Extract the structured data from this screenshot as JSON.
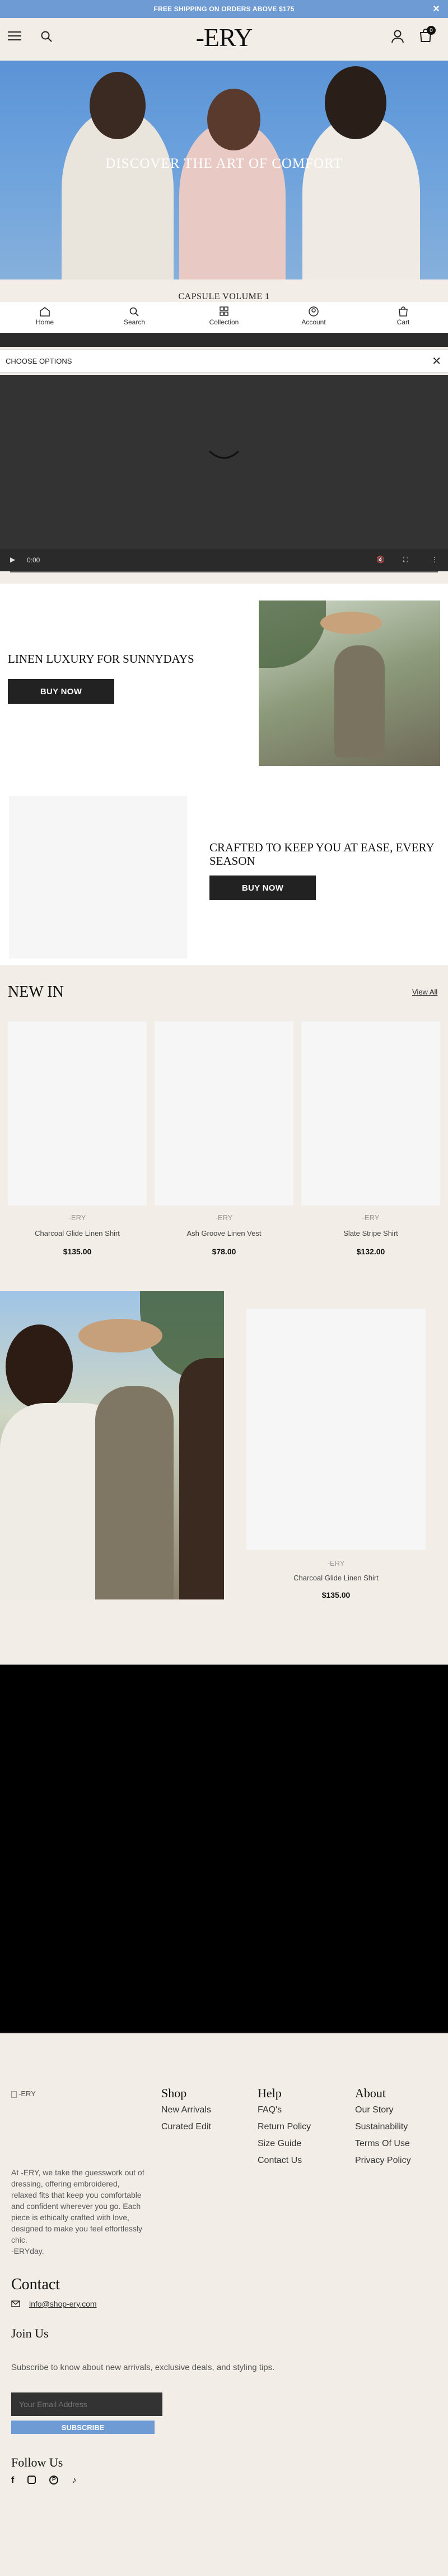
{
  "announcement": {
    "text": "FREE SHIPPING ON ORDERS ABOVE $175",
    "close": "✕"
  },
  "header": {
    "logo": "-ERY",
    "cart_count": "0"
  },
  "hero": {
    "title": "DISCOVER THE ART OF COMFORT",
    "subtitle": "CAPSULE VOLUME 1"
  },
  "bottom_nav": [
    {
      "label": "Home",
      "icon": "home-icon"
    },
    {
      "label": "Search",
      "icon": "search-icon"
    },
    {
      "label": "Collection",
      "icon": "grid-icon"
    },
    {
      "label": "Account",
      "icon": "account-icon"
    },
    {
      "label": "Cart",
      "icon": "cart-icon"
    }
  ],
  "options_bar": {
    "label": "CHOOSE OPTIONS"
  },
  "video": {
    "time": "0:00"
  },
  "linen": {
    "title": "LINEN LUXURY FOR SUNNYDAYS",
    "button": "BUY NOW"
  },
  "crafted": {
    "title": "CRAFTED TO KEEP YOU AT EASE, EVERY SEASON",
    "button": "BUY NOW"
  },
  "new_in": {
    "title": "NEW IN",
    "view_all": "View All",
    "products": [
      {
        "brand": "-ERY",
        "name": "Charcoal Glide Linen Shirt",
        "price": "$135.00"
      },
      {
        "brand": "-ERY",
        "name": "Ash Groove Linen Vest",
        "price": "$78.00"
      },
      {
        "brand": "-ERY",
        "name": "Slate Stripe Shirt",
        "price": "$132.00"
      }
    ]
  },
  "feature_product": {
    "brand": "-ERY",
    "name": "Charcoal Glide Linen Shirt",
    "price": "$135.00"
  },
  "footer": {
    "logo_alt": "-ERY",
    "about_text": "At -ERY, we take the guesswork out of dressing, offering embroidered, relaxed fits that keep you comfortable and confident wherever you go. Each piece is ethically crafted with love, designed to make you feel effortlessly chic.",
    "hashtag": "-ERYday.",
    "shop": {
      "title": "Shop",
      "links": [
        "New Arrivals",
        "Curated Edit"
      ]
    },
    "help": {
      "title": "Help",
      "links": [
        "FAQ's",
        "Return Policy",
        "Size Guide",
        "Contact Us"
      ]
    },
    "about": {
      "title": "About",
      "links": [
        "Our Story",
        "Sustainability",
        "Terms Of Use",
        "Privacy Policy"
      ]
    },
    "contact": {
      "title": "Contact",
      "email": "info@shop-ery.com"
    },
    "join": {
      "title": "Join Us",
      "text": "Subscribe to know about new arrivals, exclusive deals, and styling tips.",
      "placeholder": "Your Email Address",
      "button": "SUBSCRIBE"
    },
    "follow": {
      "title": "Follow Us",
      "icons": [
        "facebook-icon",
        "instagram-icon",
        "pinterest-icon",
        "tiktok-icon"
      ]
    }
  },
  "colors": {
    "accent": "#6e9bd4",
    "background": "#f2ede6",
    "dark": "#222222"
  }
}
